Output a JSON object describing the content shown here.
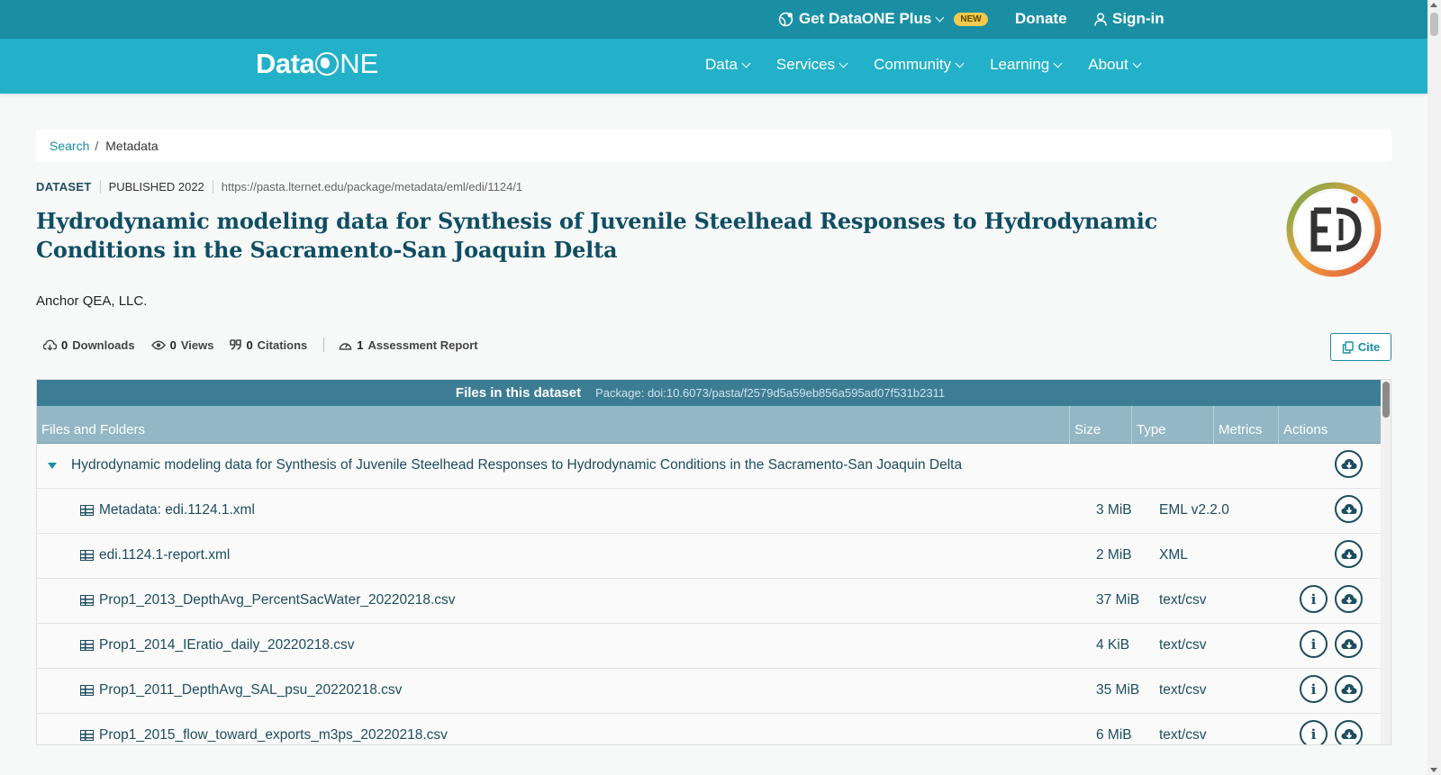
{
  "topbar": {
    "plus_label": "Get DataONE Plus",
    "new_badge": "NEW",
    "donate_label": "Donate",
    "signin_label": "Sign-in"
  },
  "nav": {
    "logo_data": "Data",
    "logo_one": "NE",
    "items": [
      "Data",
      "Services",
      "Community",
      "Learning",
      "About"
    ]
  },
  "breadcrumb": {
    "search": "Search",
    "separator": "/",
    "current": "Metadata"
  },
  "dataset": {
    "type": "DATASET",
    "published": "PUBLISHED 2022",
    "url": "https://pasta.lternet.edu/package/metadata/eml/edi/1124/1",
    "title": "Hydrodynamic modeling data for Synthesis of Juvenile Steelhead Responses to Hydrodynamic Conditions in the Sacramento-San Joaquin Delta",
    "author": "Anchor QEA, LLC."
  },
  "stats": {
    "downloads_num": "0",
    "downloads_label": "Downloads",
    "views_num": "0",
    "views_label": "Views",
    "citations_num": "0",
    "citations_label": "Citations",
    "report_num": "1",
    "report_label": "Assessment Report",
    "cite_label": "Cite"
  },
  "files": {
    "title": "Files in this dataset",
    "package": "Package: doi:10.6073/pasta/f2579d5a59eb856a595ad07f531b2311",
    "columns": {
      "name": "Files and Folders",
      "size": "Size",
      "type": "Type",
      "metrics": "Metrics",
      "actions": "Actions"
    },
    "folder": "Hydrodynamic modeling data for Synthesis of Juvenile Steelhead Responses to Hydrodynamic Conditions in the Sacramento-San Joaquin Delta",
    "rows": [
      {
        "name": "Metadata: edi.1124.1.xml",
        "size": "3 MiB",
        "type": "EML v2.2.0"
      },
      {
        "name": "edi.1124.1-report.xml",
        "size": "2 MiB",
        "type": "XML"
      },
      {
        "name": "Prop1_2013_DepthAvg_PercentSacWater_20220218.csv",
        "size": "37 MiB",
        "type": "text/csv"
      },
      {
        "name": "Prop1_2014_IEratio_daily_20220218.csv",
        "size": "4 KiB",
        "type": "text/csv"
      },
      {
        "name": "Prop1_2011_DepthAvg_SAL_psu_20220218.csv",
        "size": "35 MiB",
        "type": "text/csv"
      },
      {
        "name": "Prop1_2015_flow_toward_exports_m3ps_20220218.csv",
        "size": "6 MiB",
        "type": "text/csv"
      }
    ]
  },
  "colors": {
    "topbar": "#1a8fa3",
    "navbar": "#22b1c8",
    "title": "#0f4e63",
    "table_header": "#3d7d94"
  }
}
